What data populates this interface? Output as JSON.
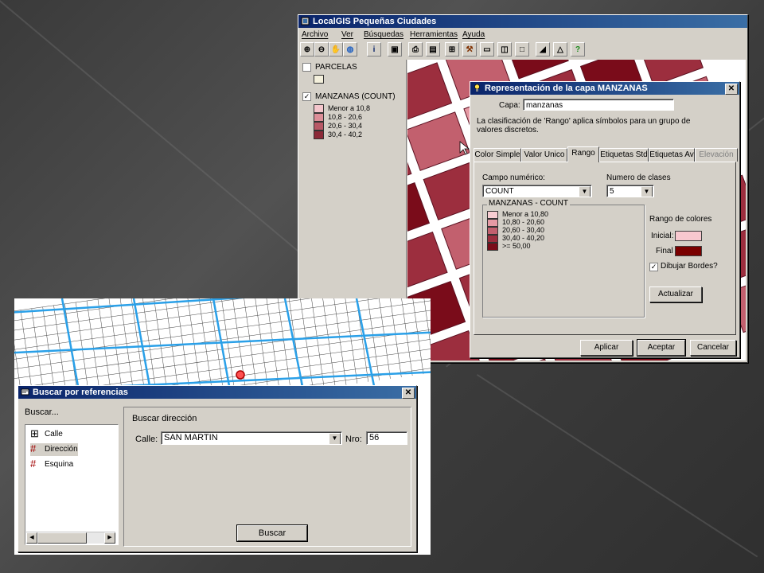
{
  "gis": {
    "title": "LocalGIS Pequeñas Ciudades",
    "menu": [
      "Archivo",
      "Ver",
      "Búsquedas",
      "Herramientas",
      "Ayuda"
    ],
    "toolbar_icons": [
      "zoom-in-icon",
      "zoom-out-icon",
      "pan-hand-icon",
      "globe-icon",
      "info-icon",
      "layer-properties-icon",
      "print-icon",
      "table-icon",
      "select-grid-icon",
      "hammer-icon",
      "image-icon",
      "query-icon",
      "blank-page-icon",
      "ruler-icon",
      "measure-icon",
      "help-icon"
    ],
    "layers": [
      {
        "name": "PARCELAS",
        "checked": false,
        "legend": []
      },
      {
        "name": "MANZANAS (COUNT)",
        "checked": true,
        "legend": [
          {
            "label": "Menor a 10,8",
            "color": "#f4c6cc"
          },
          {
            "label": "10,8 - 20,6",
            "color": "#dc8e98"
          },
          {
            "label": "20,6 - 30,4",
            "color": "#b85866"
          },
          {
            "label": "30,4 - 40,2",
            "color": "#8c2a38"
          }
        ]
      }
    ]
  },
  "rep_dialog": {
    "title": "Representación de la capa MANZANAS",
    "capa_label": "Capa:",
    "capa_value": "manzanas",
    "description": "La clasificación de 'Rango' aplica símbolos para un grupo de valores discretos.",
    "tabs": [
      "Color Simple",
      "Valor Unico",
      "Rango",
      "Etiquetas Std",
      "Etiquetas Av",
      "Elevación"
    ],
    "campo_label": "Campo numérico:",
    "campo_value": "COUNT",
    "clases_label": "Numero de clases",
    "clases_value": "5",
    "group_title": "MANZANAS - COUNT",
    "ranges": [
      {
        "label": "Menor a 10,80",
        "color": "#f8cdd2"
      },
      {
        "label": "10,80 - 20,60",
        "color": "#e59aa4"
      },
      {
        "label": "20,60 - 30,40",
        "color": "#c2606e"
      },
      {
        "label": "30,40 - 40,20",
        "color": "#9c2e3e"
      },
      {
        "label": ">= 50,00",
        "color": "#7a0c1a"
      }
    ],
    "rango_colores_label": "Rango de colores",
    "inicial_label": "Inicial:",
    "inicial_color": "#f8c8cf",
    "final_label": "Final",
    "final_color": "#7a0000",
    "bordes_label": "Dibujar Bordes?",
    "actualizar": "Actualizar",
    "aplicar": "Aplicar",
    "aceptar": "Aceptar",
    "cancelar": "Cancelar"
  },
  "search_dialog": {
    "title": "Buscar por referencias",
    "buscar_label": "Buscar...",
    "options": [
      "Calle",
      "Dirección",
      "Esquina"
    ],
    "group_title": "Buscar dirección",
    "calle_label": "Calle:",
    "calle_value": "SAN MARTIN",
    "nro_label": "Nro:",
    "nro_value": "56",
    "buscar_button": "Buscar"
  }
}
